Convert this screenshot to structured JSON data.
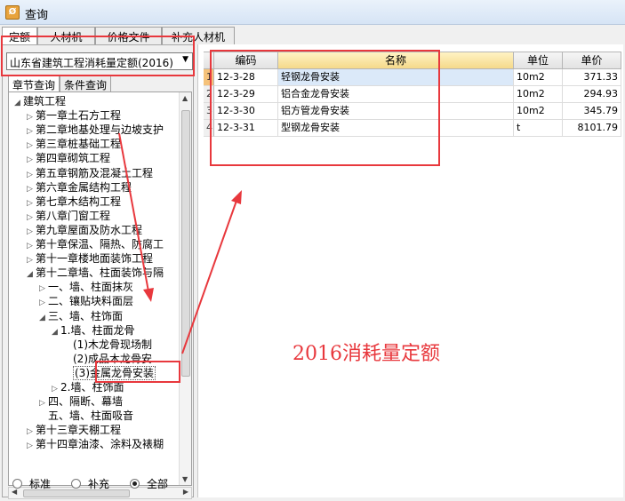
{
  "window": {
    "title": "查询",
    "icon": "app-icon"
  },
  "tabs": [
    {
      "label": "定额",
      "active": true
    },
    {
      "label": "人材机",
      "active": false
    },
    {
      "label": "价格文件",
      "active": false
    },
    {
      "label": "补充人材机",
      "active": false
    }
  ],
  "quota_selector": {
    "value": "山东省建筑工程消耗量定额(2016)"
  },
  "sub_tabs": [
    {
      "label": "章节查询",
      "active": true
    },
    {
      "label": "条件查询",
      "active": false
    }
  ],
  "tree": [
    {
      "label": "建筑工程",
      "depth": 0,
      "toggle": "open"
    },
    {
      "label": "第一章土石方工程",
      "depth": 1,
      "toggle": "closed"
    },
    {
      "label": "第二章地基处理与边坡支护",
      "depth": 1,
      "toggle": "closed"
    },
    {
      "label": "第三章桩基础工程",
      "depth": 1,
      "toggle": "closed"
    },
    {
      "label": "第四章砌筑工程",
      "depth": 1,
      "toggle": "closed"
    },
    {
      "label": "第五章钢筋及混凝土工程",
      "depth": 1,
      "toggle": "closed"
    },
    {
      "label": "第六章金属结构工程",
      "depth": 1,
      "toggle": "closed"
    },
    {
      "label": "第七章木结构工程",
      "depth": 1,
      "toggle": "closed"
    },
    {
      "label": "第八章门窗工程",
      "depth": 1,
      "toggle": "closed"
    },
    {
      "label": "第九章屋面及防水工程",
      "depth": 1,
      "toggle": "closed"
    },
    {
      "label": "第十章保温、隔热、防腐工",
      "depth": 1,
      "toggle": "closed"
    },
    {
      "label": "第十一章楼地面装饰工程",
      "depth": 1,
      "toggle": "closed"
    },
    {
      "label": "第十二章墙、柱面装饰与隔",
      "depth": 1,
      "toggle": "open"
    },
    {
      "label": "一、墙、柱面抹灰",
      "depth": 2,
      "toggle": "closed"
    },
    {
      "label": "二、镶贴块料面层",
      "depth": 2,
      "toggle": "closed"
    },
    {
      "label": "三、墙、柱饰面",
      "depth": 2,
      "toggle": "open"
    },
    {
      "label": "1.墙、柱面龙骨",
      "depth": 3,
      "toggle": "open"
    },
    {
      "label": "(1)木龙骨现场制",
      "depth": 4,
      "toggle": ""
    },
    {
      "label": "(2)成品木龙骨安",
      "depth": 4,
      "toggle": ""
    },
    {
      "label": "(3)金属龙骨安装",
      "depth": 4,
      "toggle": "",
      "selected": true
    },
    {
      "label": "2.墙、柱饰面",
      "depth": 3,
      "toggle": "closed"
    },
    {
      "label": "四、隔断、幕墙",
      "depth": 2,
      "toggle": "closed"
    },
    {
      "label": "五、墙、柱面吸音",
      "depth": 2,
      "toggle": ""
    },
    {
      "label": "第十三章天棚工程",
      "depth": 1,
      "toggle": "closed"
    },
    {
      "label": "第十四章油漆、涂料及裱糊",
      "depth": 1,
      "toggle": "closed"
    }
  ],
  "filter": {
    "options": [
      {
        "label": "标准",
        "checked": false
      },
      {
        "label": "补充",
        "checked": false
      },
      {
        "label": "全部",
        "checked": true
      }
    ]
  },
  "table": {
    "columns": [
      "编码",
      "名称",
      "单位",
      "单价"
    ],
    "rows": [
      {
        "index": "1",
        "code": "12-3-28",
        "name": "轻钢龙骨安装",
        "unit": "10m2",
        "price": "371.33"
      },
      {
        "index": "2",
        "code": "12-3-29",
        "name": "铝合金龙骨安装",
        "unit": "10m2",
        "price": "294.93"
      },
      {
        "index": "3",
        "code": "12-3-30",
        "name": "铝方管龙骨安装",
        "unit": "10m2",
        "price": "345.79"
      },
      {
        "index": "4",
        "code": "12-3-31",
        "name": "型钢龙骨安装",
        "unit": "t",
        "price": "8101.79"
      }
    ]
  },
  "annotation": {
    "text": "2016消耗量定额"
  },
  "colors": {
    "annotation": "#e8383d",
    "selected_row": "#dbe9f9",
    "header_highlight": "#f5d98a"
  }
}
